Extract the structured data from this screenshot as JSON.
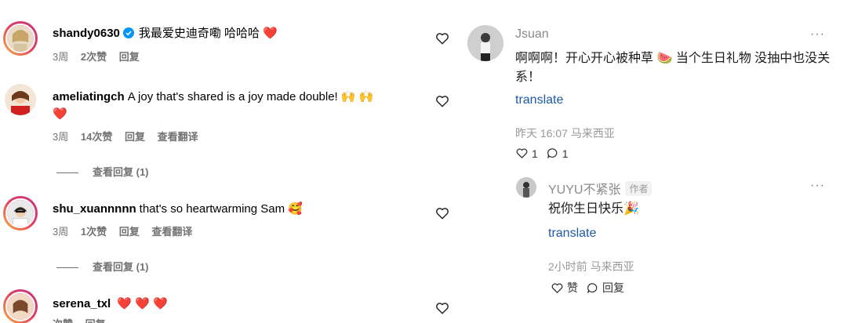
{
  "left_comments": [
    {
      "username": "shandy0630",
      "verified": true,
      "text": "我最爱史迪奇嘞 哈哈哈",
      "emoji": "❤️",
      "time": "3周",
      "likes": "2次赞",
      "reply": "回复",
      "translate": ""
    },
    {
      "username": "ameliatingch",
      "text": "A joy that's shared is a joy made double!",
      "emoji": "🙌 🙌",
      "emoji2": "❤️",
      "time": "3周",
      "likes": "14次赞",
      "reply": "回复",
      "translate": "查看翻译",
      "view_replies": "查看回复 (1)"
    },
    {
      "username": "shu_xuannnnn",
      "text": "that's so heartwarming Sam",
      "emoji": "🥰",
      "time": "3周",
      "likes": "1次赞",
      "reply": "回复",
      "translate": "查看翻译",
      "view_replies": "查看回复 (1)"
    },
    {
      "username": "serena_txl",
      "emoji": "❤️ ❤️ ❤️",
      "time": "",
      "likes": "次赞",
      "reply": "回复"
    }
  ],
  "right_comment": {
    "name": "Jsuan",
    "more": "···",
    "text": "啊啊啊！开心开心被种草 🍉 当个生日礼物 没抽中也没关系！",
    "translate": "translate",
    "time_location": "昨天 16:07 马来西亚",
    "likes": "1",
    "comments": "1",
    "reply": {
      "name": "YUYU不紧张",
      "tag": "作者",
      "more": "···",
      "text": "祝你生日快乐🎉",
      "translate": "translate",
      "time_location": "2小时前 马来西亚",
      "like_label": "赞",
      "reply_label": "回复"
    }
  },
  "colors": {
    "accent_blue": "#1e5aa8",
    "verified_blue": "#0095f6",
    "heart_red": "#e0245e",
    "muted_gray": "#737373"
  }
}
